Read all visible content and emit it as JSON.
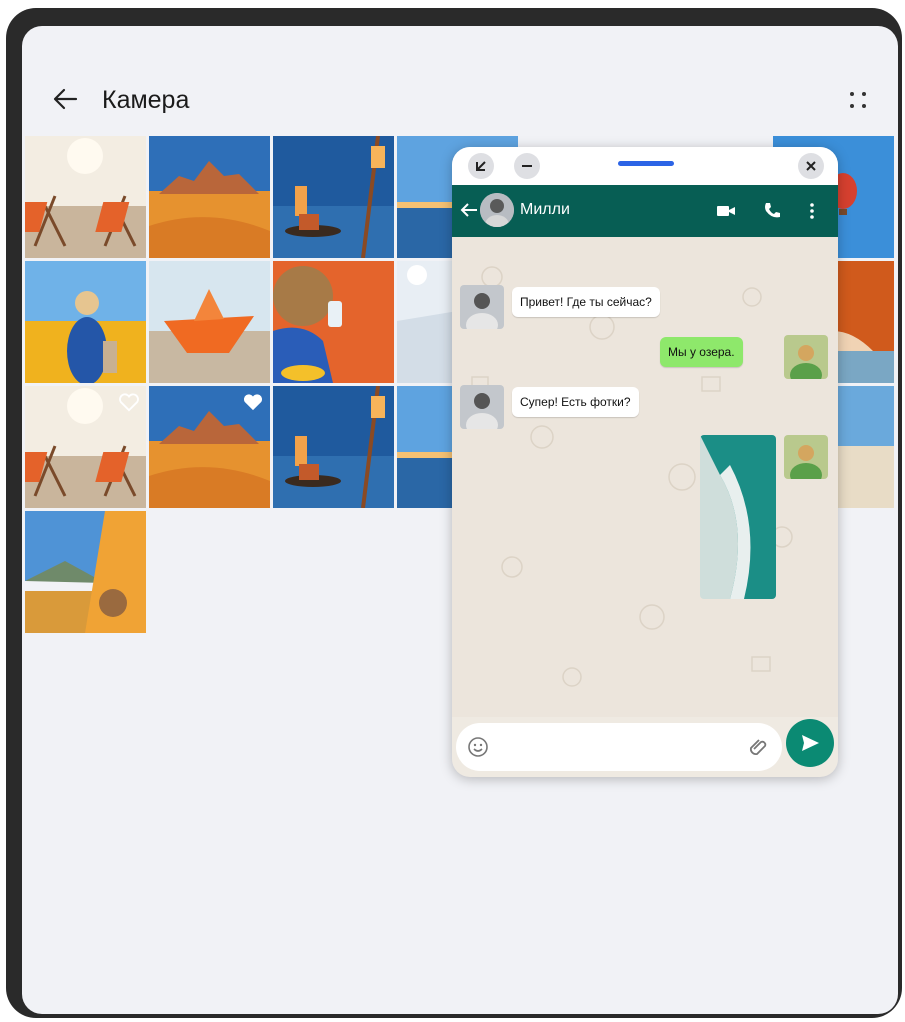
{
  "gallery": {
    "title": "Камера",
    "back_icon": "arrow-left-icon",
    "more_icon": "more-dots-icon"
  },
  "photos": [
    {
      "name": "beach-chairs",
      "favorite": false
    },
    {
      "name": "desert-rocks",
      "favorite": false
    },
    {
      "name": "lantern-sea",
      "favorite": false
    },
    {
      "name": "sea-horizon",
      "favorite": false
    },
    {
      "name": "balloon-sky",
      "favorite": false
    },
    {
      "name": "woman-field",
      "favorite": false
    },
    {
      "name": "paper-boat",
      "favorite": false
    },
    {
      "name": "beach-items",
      "favorite": false
    },
    {
      "name": "snow-sun",
      "favorite": false
    },
    {
      "name": "orange-arch",
      "favorite": false
    },
    {
      "name": "beach-chairs",
      "favorite": true
    },
    {
      "name": "desert-rocks",
      "favorite": true
    },
    {
      "name": "lantern-sea",
      "favorite": false
    },
    {
      "name": "sea-horizon",
      "favorite": false
    },
    {
      "name": "orange-ball-beach",
      "favorite": false
    },
    {
      "name": "tent-bear",
      "favorite": false
    }
  ],
  "chat": {
    "contact_name": "Милли",
    "messages": [
      {
        "direction": "in",
        "text": "Привет! Где ты сейчас?"
      },
      {
        "direction": "out",
        "text": "Мы у озера."
      },
      {
        "direction": "in",
        "text": "Супер! Есть фотки?"
      },
      {
        "direction": "out",
        "type": "image",
        "text": ""
      }
    ],
    "input_placeholder": "",
    "colors": {
      "header": "#075e54",
      "outgoing": "#8ee86b",
      "incoming": "#ffffff",
      "send": "#0b8a73"
    }
  }
}
